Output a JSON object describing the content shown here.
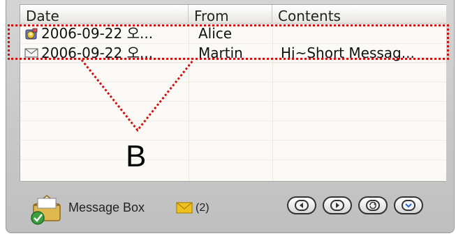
{
  "list": {
    "columns": [
      "Date",
      "From",
      "Contents"
    ],
    "rows": [
      {
        "icon": "contact-card-icon",
        "date": "2006-09-22 오...",
        "from": "Alice",
        "contents": ""
      },
      {
        "icon": "envelope-icon",
        "date": "2006-09-22 오...",
        "from": "Martin",
        "contents": "Hi~Short Messag..."
      }
    ]
  },
  "annotation": {
    "label": "B",
    "color": "#d01010"
  },
  "footer": {
    "title": "Message Box",
    "count": "(2)",
    "buttons": [
      "previous",
      "next",
      "refresh",
      "dropdown"
    ]
  },
  "colors": {
    "accent_red": "#d01010",
    "envelope": "#f0c020",
    "dropdown_arrow": "#2a63d6"
  }
}
